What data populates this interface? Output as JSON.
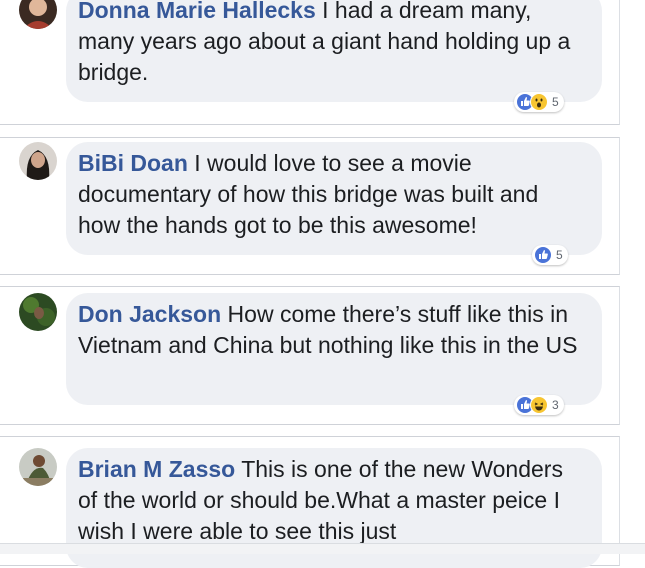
{
  "comments": [
    {
      "author": "Donna Marie Hallecks",
      "text": "I had a dream many, many years ago about a giant hand holding up a bridge.",
      "reactions": [
        "like",
        "wow"
      ],
      "reaction_count": "5"
    },
    {
      "author": "BiBi Doan",
      "text": "I would love to see a movie documentary of how this bridge was built and how the hands got to be this awesome!",
      "reactions": [
        "like"
      ],
      "reaction_count": "5"
    },
    {
      "author": "Don Jackson",
      "text": "How come there’s stuff like this in Vietnam and China but nothing like this in the US",
      "reactions": [
        "like",
        "haha"
      ],
      "reaction_count": "3"
    },
    {
      "author": "Brian M Zasso",
      "text": "This is one of the new Wonders of the world or should be.What a master peice I wish I were able to see this just",
      "reactions": [],
      "reaction_count": ""
    }
  ],
  "colors": {
    "author_link": "#365899",
    "bubble_bg": "#eef0f4",
    "like_blue": "#4a73d8",
    "emoji_yellow": "#f7c531"
  }
}
